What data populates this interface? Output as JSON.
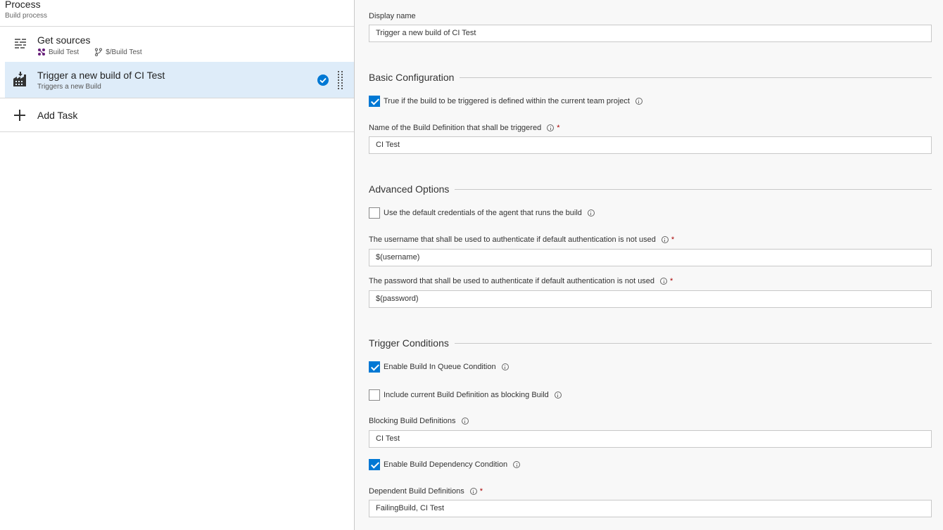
{
  "process": {
    "title": "Process",
    "subtitle": "Build process"
  },
  "tasks": [
    {
      "name": "Get sources",
      "meta_repo": "Build Test",
      "meta_path": "$/Build Test",
      "icon": "get-sources-icon"
    },
    {
      "name": "Trigger a new build of CI Test",
      "subtitle": "Triggers a new Build",
      "icon": "trigger-build-icon",
      "selected": true
    }
  ],
  "add_task": {
    "label": "Add Task"
  },
  "form": {
    "display_name": {
      "label": "Display name",
      "value": "Trigger a new build of CI Test"
    },
    "basic": {
      "title": "Basic Configuration",
      "current_project": {
        "label": "True if the build to be triggered is defined within the current team project",
        "checked": true
      },
      "build_def": {
        "label": "Name of the Build Definition that shall be triggered",
        "value": "CI Test",
        "required": "*"
      }
    },
    "advanced": {
      "title": "Advanced Options",
      "default_creds": {
        "label": "Use the default credentials of the agent that runs the build",
        "checked": false
      },
      "username": {
        "label": "The username that shall be used to authenticate if default authentication is not used",
        "value": "$(username)",
        "required": "*"
      },
      "password": {
        "label": "The password that shall be used to authenticate if default authentication is not used",
        "value": "$(password)",
        "required": "*"
      }
    },
    "trigger": {
      "title": "Trigger Conditions",
      "queue_condition": {
        "label": "Enable Build In Queue Condition",
        "checked": true
      },
      "include_current": {
        "label": "Include current Build Definition as blocking Build",
        "checked": false
      },
      "blocking": {
        "label": "Blocking Build Definitions",
        "value": "CI Test"
      },
      "dependency_condition": {
        "label": "Enable Build Dependency Condition",
        "checked": true
      },
      "dependent": {
        "label": "Dependent Build Definitions",
        "value": "FailingBuild, CI Test",
        "required": "*"
      }
    }
  },
  "colors": {
    "accent": "#0078d4",
    "selected_bg": "#deecf9",
    "required": "#a80000"
  }
}
